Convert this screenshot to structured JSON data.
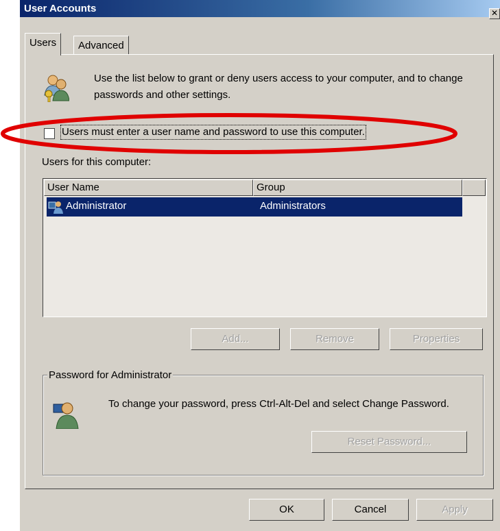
{
  "window": {
    "title": "User Accounts",
    "close_glyph": "✕"
  },
  "tabs": [
    {
      "label": "Users",
      "active": true
    },
    {
      "label": "Advanced",
      "active": false
    }
  ],
  "intro_text": "Use the list below to grant or deny users access to your computer, and to change passwords and other settings.",
  "require_password": {
    "label": "Users must enter a user name and password to use this computer.",
    "checked": false
  },
  "users_label": "Users for this computer:",
  "user_list": {
    "columns": [
      "User Name",
      "Group"
    ],
    "rows": [
      {
        "user_name": "Administrator",
        "group": "Administrators",
        "selected": true,
        "icon": "admin-user-icon"
      }
    ]
  },
  "list_buttons": {
    "add": "Add...",
    "remove": "Remove",
    "properties": "Properties"
  },
  "password_group": {
    "title": "Password for Administrator",
    "text": "To change your password, press Ctrl-Alt-Del and select Change Password.",
    "reset_button": "Reset Password..."
  },
  "dialog_buttons": {
    "ok": "OK",
    "cancel": "Cancel",
    "apply": "Apply"
  },
  "annotation": {
    "shape": "ellipse",
    "color": "#e00000"
  },
  "colors": {
    "selection": "#0a246a",
    "face": "#d4d0c8"
  }
}
